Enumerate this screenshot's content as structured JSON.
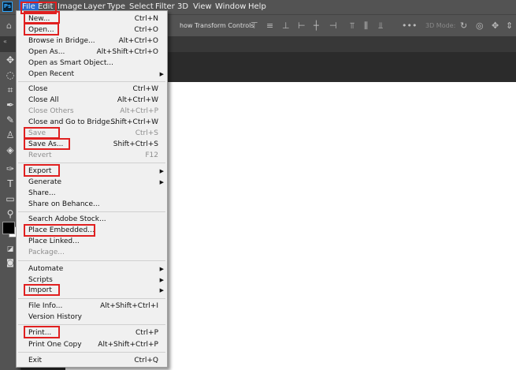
{
  "app": {
    "logo": "Ps"
  },
  "menubar": [
    {
      "label": "File",
      "active": true
    },
    {
      "label": "Edit"
    },
    {
      "label": "Image"
    },
    {
      "label": "Layer"
    },
    {
      "label": "Type"
    },
    {
      "label": "Select"
    },
    {
      "label": "Filter"
    },
    {
      "label": "3D"
    },
    {
      "label": "View"
    },
    {
      "label": "Window"
    },
    {
      "label": "Help"
    }
  ],
  "options_bar": {
    "show_transform_label": "how Transform Controls",
    "mode_3d_label": "3D Mode:"
  },
  "file_menu": {
    "items": [
      {
        "label": "New...",
        "shortcut": "Ctrl+N",
        "highlighted": true
      },
      {
        "label": "Open...",
        "shortcut": "Ctrl+O",
        "highlighted": true
      },
      {
        "label": "Browse in Bridge...",
        "shortcut": "Alt+Ctrl+O"
      },
      {
        "label": "Open As...",
        "shortcut": "Alt+Shift+Ctrl+O"
      },
      {
        "label": "Open as Smart Object..."
      },
      {
        "label": "Open Recent",
        "submenu": true
      },
      {
        "label": "Close",
        "shortcut": "Ctrl+W"
      },
      {
        "label": "Close All",
        "shortcut": "Alt+Ctrl+W"
      },
      {
        "label": "Close Others",
        "shortcut": "Alt+Ctrl+P",
        "disabled": true
      },
      {
        "label": "Close and Go to Bridge...",
        "shortcut": "Shift+Ctrl+W"
      },
      {
        "label": "Save",
        "shortcut": "Ctrl+S",
        "disabled": true,
        "highlighted": true
      },
      {
        "label": "Save As...",
        "shortcut": "Shift+Ctrl+S",
        "highlighted": true
      },
      {
        "label": "Revert",
        "shortcut": "F12",
        "disabled": true
      },
      {
        "label": "Export",
        "submenu": true,
        "highlighted": true
      },
      {
        "label": "Generate",
        "submenu": true
      },
      {
        "label": "Share..."
      },
      {
        "label": "Share on Behance..."
      },
      {
        "label": "Search Adobe Stock..."
      },
      {
        "label": "Place Embedded...",
        "highlighted": true
      },
      {
        "label": "Place Linked..."
      },
      {
        "label": "Package...",
        "disabled": true
      },
      {
        "label": "Automate",
        "submenu": true
      },
      {
        "label": "Scripts",
        "submenu": true
      },
      {
        "label": "Import",
        "submenu": true,
        "highlighted": true
      },
      {
        "label": "File Info...",
        "shortcut": "Alt+Shift+Ctrl+I"
      },
      {
        "label": "Version History"
      },
      {
        "label": "Print...",
        "shortcut": "Ctrl+P",
        "highlighted": true
      },
      {
        "label": "Print One Copy",
        "shortcut": "Alt+Shift+Ctrl+P"
      },
      {
        "label": "Exit",
        "shortcut": "Ctrl+Q"
      }
    ]
  },
  "tools": [
    "move-tool",
    "lasso-tool",
    "crop-tool",
    "eyedropper-tool",
    "brush-tool",
    "eraser-tool",
    "paint-bucket-tool",
    "pen-tool",
    "type-tool",
    "rectangle-tool",
    "zoom-tool"
  ],
  "colors": {
    "highlight": "#e02020",
    "menubar_bg": "#535353",
    "menu_bg": "#f0f0f0",
    "active_menu": "#2b6cd1"
  }
}
